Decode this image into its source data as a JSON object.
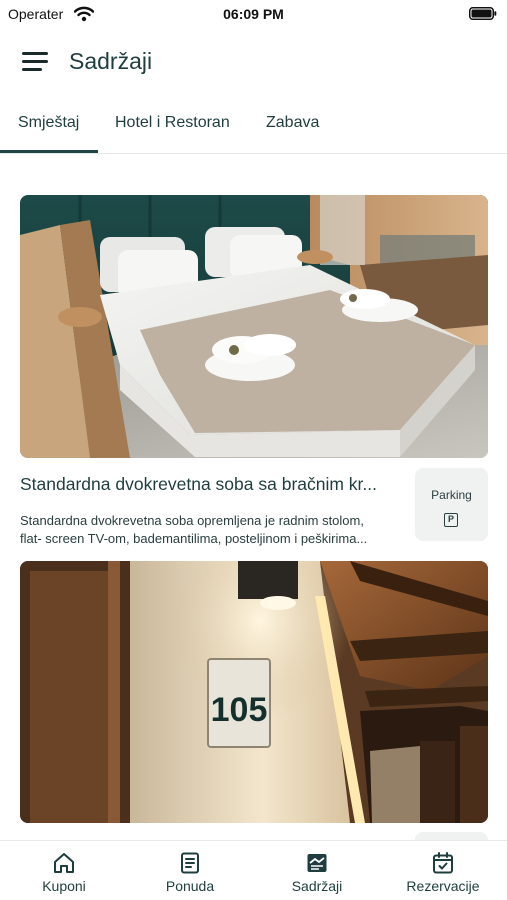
{
  "status_bar": {
    "carrier": "Operater",
    "time": "06:09 PM"
  },
  "header": {
    "title": "Sadržaji",
    "menu_icon": "hamburger-menu-icon"
  },
  "tabs": [
    {
      "label": "Smještaj",
      "active": true
    },
    {
      "label": "Hotel i Restoran",
      "active": false
    },
    {
      "label": "Zabava",
      "active": false
    }
  ],
  "cards": [
    {
      "image": "double-bed-room-photo",
      "title": "Standardna dvokrevetna soba sa bračnim kr...",
      "description_line1": "Standardna dvokrevetna soba opremljena je radnim stolom,",
      "description_line2": "flat- screen TV-om, bademantilima, posteljinom i peškirima...",
      "amenity": {
        "label": "Parking",
        "icon": "parking-icon",
        "icon_text": "P"
      }
    },
    {
      "image": "hotel-corridor-room-105-photo",
      "door_sign": "105"
    }
  ],
  "bottom_nav": [
    {
      "label": "Kuponi",
      "icon": "home-icon"
    },
    {
      "label": "Ponuda",
      "icon": "document-icon"
    },
    {
      "label": "Sadržaji",
      "icon": "gallery-icon",
      "active": true
    },
    {
      "label": "Rezervacije",
      "icon": "calendar-check-icon"
    }
  ],
  "colors": {
    "primary": "#1f4547",
    "text": "#1f3d3e",
    "chip_bg": "#f0f2f2"
  }
}
